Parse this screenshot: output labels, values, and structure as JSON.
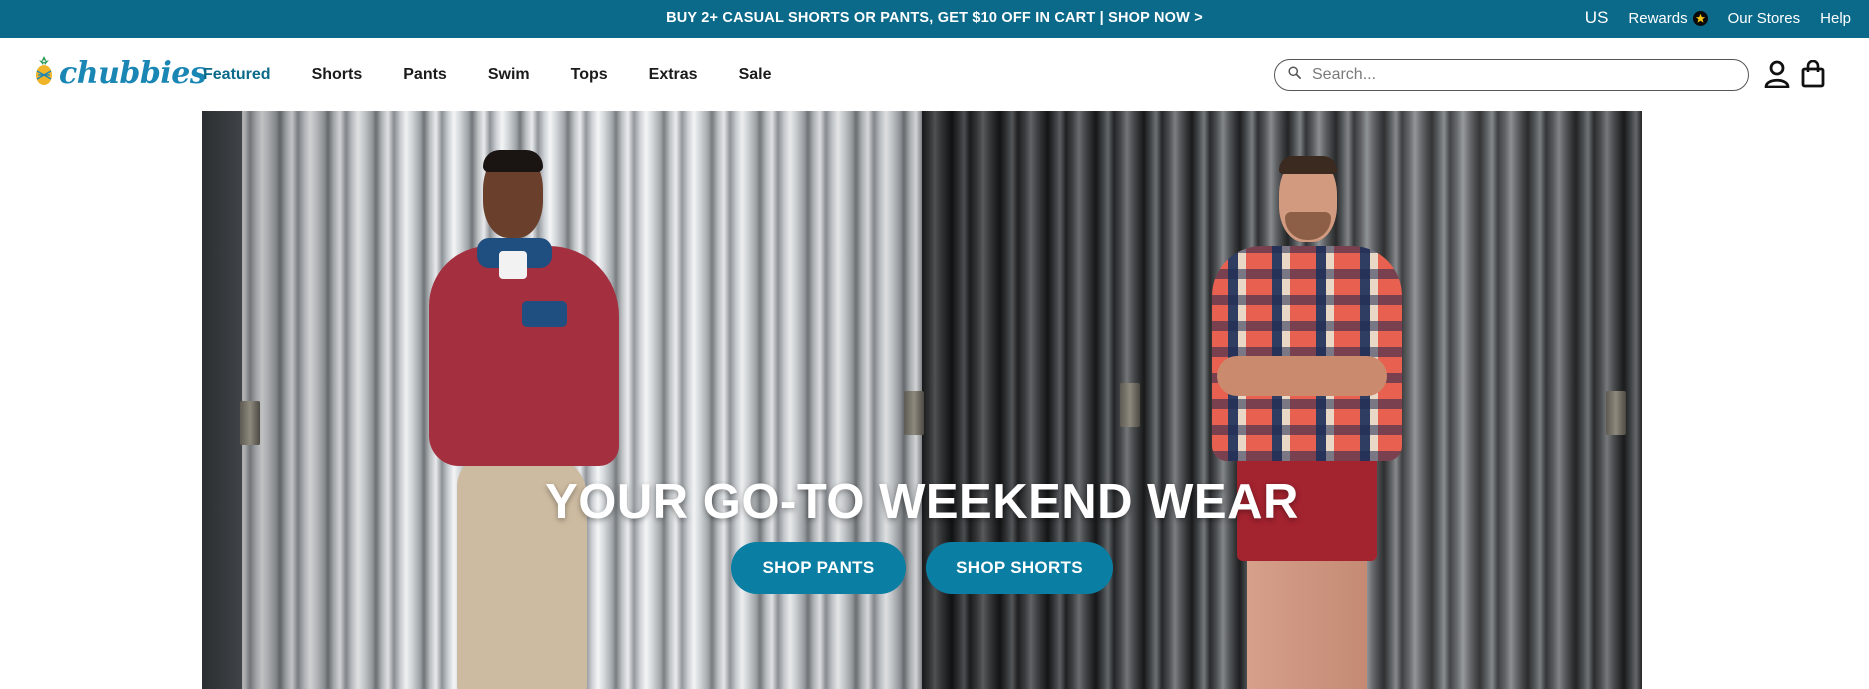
{
  "promo": {
    "text": "BUY 2+ CASUAL SHORTS OR PANTS, GET $10 OFF IN CART | SHOP NOW >",
    "country": "US",
    "rewards_label": "Rewards",
    "stores_label": "Our Stores",
    "help_label": "Help"
  },
  "header": {
    "logo_text": "chubbies",
    "nav": [
      {
        "label": "Featured",
        "active": true
      },
      {
        "label": "Shorts"
      },
      {
        "label": "Pants"
      },
      {
        "label": "Swim"
      },
      {
        "label": "Tops"
      },
      {
        "label": "Extras"
      },
      {
        "label": "Sale"
      }
    ],
    "search": {
      "placeholder": "Search..."
    },
    "icons": [
      "search-icon",
      "account-icon",
      "shopping-bag-icon",
      "pineapple-logo-icon",
      "star-icon"
    ]
  },
  "hero": {
    "headline": "YOUR GO-TO WEEKEND WEAR",
    "buttons": {
      "pants": "SHOP PANTS",
      "shorts": "SHOP SHORTS"
    }
  },
  "colors": {
    "brand": "#0b6a8a",
    "button": "#0b7ea3",
    "logo": "#1a86b4"
  }
}
